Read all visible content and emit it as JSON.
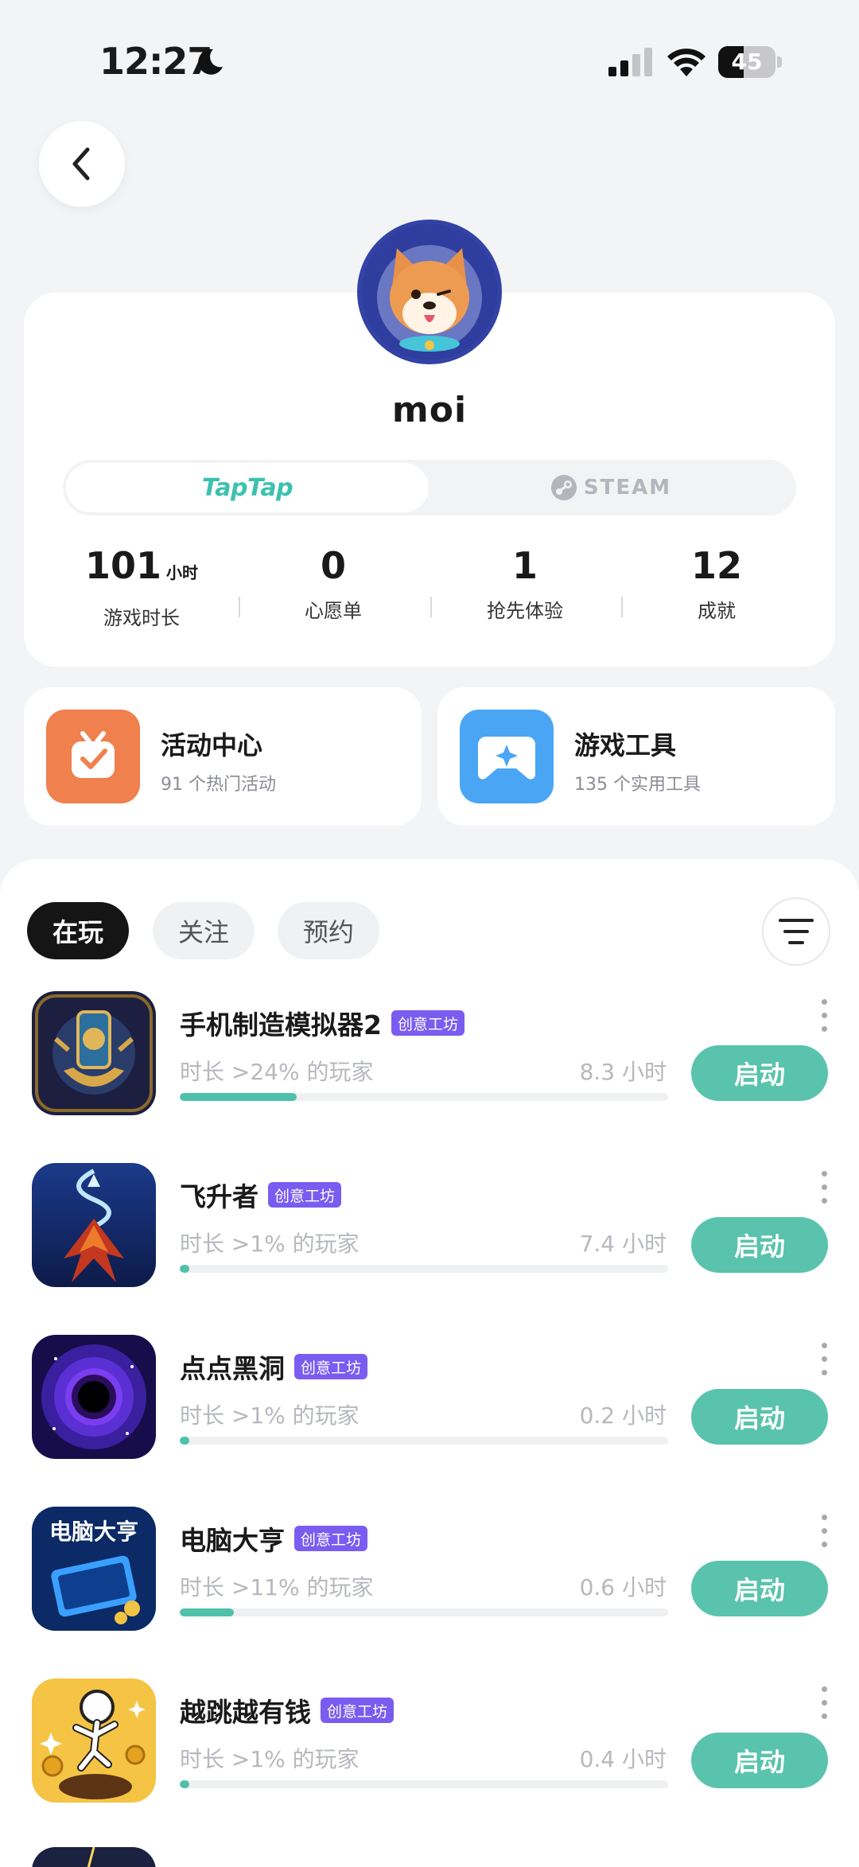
{
  "status_bar": {
    "time": "12:27",
    "battery": "45",
    "battery_level": 0.45
  },
  "profile": {
    "username": "moi",
    "platforms": {
      "taptap": "TapTap",
      "steam": "STEAM"
    },
    "stats": [
      {
        "value": "101",
        "unit": "小时",
        "label": "游戏时长"
      },
      {
        "value": "0",
        "unit": "",
        "label": "心愿单"
      },
      {
        "value": "1",
        "unit": "",
        "label": "抢先体验"
      },
      {
        "value": "12",
        "unit": "",
        "label": "成就"
      }
    ]
  },
  "features": [
    {
      "title": "活动中心",
      "subtitle": "91 个热门活动",
      "icon": "calendar-check-icon",
      "color": "#f0804d"
    },
    {
      "title": "游戏工具",
      "subtitle": "135 个实用工具",
      "icon": "gamepad-icon",
      "color": "#4aa6f5"
    }
  ],
  "tabs": {
    "playing": "在玩",
    "following": "关注",
    "reserved": "预约"
  },
  "games": [
    {
      "title": "手机制造模拟器2",
      "badge": "创意工坊",
      "desc": "时长 >24% 的玩家",
      "hours": "8.3 小时",
      "percentile": 0.24,
      "action": "启动",
      "icon": "phone-maker-game-icon"
    },
    {
      "title": "飞升者",
      "badge": "创意工坊",
      "desc": "时长 >1% 的玩家",
      "hours": "7.4 小时",
      "percentile": 0.01,
      "action": "启动",
      "icon": "phoenix-game-icon"
    },
    {
      "title": "点点黑洞",
      "badge": "创意工坊",
      "desc": "时长 >1% 的玩家",
      "hours": "0.2 小时",
      "percentile": 0.01,
      "action": "启动",
      "icon": "black-hole-game-icon"
    },
    {
      "title": "电脑大亨",
      "badge": "创意工坊",
      "desc": "时长 >11% 的玩家",
      "hours": "0.6 小时",
      "percentile": 0.11,
      "action": "启动",
      "icon": "computer-tycoon-game-icon",
      "icon_text": "电脑大亨"
    },
    {
      "title": "越跳越有钱",
      "badge": "创意工坊",
      "desc": "时长 >1% 的玩家",
      "hours": "0.4 小时",
      "percentile": 0.01,
      "action": "启动",
      "icon": "jump-money-game-icon"
    }
  ]
}
